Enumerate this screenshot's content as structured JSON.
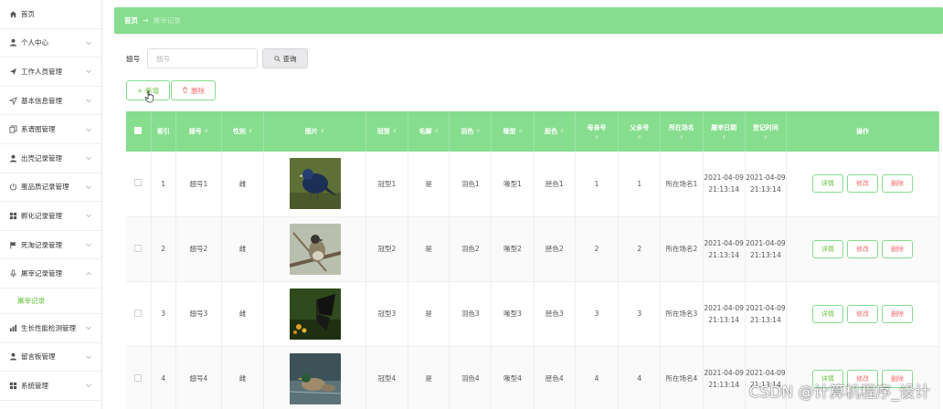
{
  "sidebar": {
    "items": [
      {
        "label": "首页",
        "icon": "home-icon",
        "expandable": false
      },
      {
        "label": "个人中心",
        "icon": "user-icon",
        "expandable": true
      },
      {
        "label": "工作人员管理",
        "icon": "send-icon",
        "expandable": true
      },
      {
        "label": "基本信息管理",
        "icon": "navigation-icon",
        "expandable": true
      },
      {
        "label": "系谱图管理",
        "icon": "copy-icon",
        "expandable": true
      },
      {
        "label": "出壳记录管理",
        "icon": "user-icon",
        "expandable": true
      },
      {
        "label": "蛋品质记录管理",
        "icon": "power-icon",
        "expandable": true
      },
      {
        "label": "孵化记录管理",
        "icon": "grid-icon",
        "expandable": true
      },
      {
        "label": "死淘记录管理",
        "icon": "flag-icon",
        "expandable": true
      },
      {
        "label": "屠宰记录管理",
        "icon": "microphone-icon",
        "expandable": true,
        "expanded": true
      },
      {
        "label": "生长性能检测管理",
        "icon": "chart-icon",
        "expandable": true
      },
      {
        "label": "留言板管理",
        "icon": "user-icon",
        "expandable": true
      },
      {
        "label": "系统管理",
        "icon": "grid-icon",
        "expandable": true
      }
    ],
    "active_sub": "屠宰记录"
  },
  "breadcrumb": {
    "home": "首页",
    "arrow": "→",
    "current": "屠宰记录"
  },
  "search": {
    "label": "翅号",
    "placeholder": "翅号",
    "button": "查询"
  },
  "actions": {
    "add": "新增",
    "delete": "删除"
  },
  "table": {
    "headers": [
      "索引",
      "翅号",
      "性别",
      "图片",
      "冠型",
      "毛脚",
      "羽色",
      "喙型",
      "胫色",
      "母亲号",
      "父亲号",
      "所在场名",
      "屠宰日期",
      "登记时间",
      "操作"
    ],
    "rows": [
      {
        "index": "1",
        "wing": "翅号1",
        "sex": "雌",
        "photo": "bird-photo",
        "comb": "冠型1",
        "feather_foot": "是",
        "color": "羽色1",
        "beak": "喙型1",
        "shank": "胫色1",
        "mother": "1",
        "father": "1",
        "farm": "所在场名1",
        "slaughter_date": "2021-04-09 21:13:14",
        "register_time": "2021-04-09 21:13:14"
      },
      {
        "index": "2",
        "wing": "翅号2",
        "sex": "雌",
        "photo": "bird-photo",
        "comb": "冠型2",
        "feather_foot": "是",
        "color": "羽色2",
        "beak": "喙型2",
        "shank": "胫色2",
        "mother": "2",
        "father": "2",
        "farm": "所在场名2",
        "slaughter_date": "2021-04-09 21:13:14",
        "register_time": "2021-04-09 21:13:14"
      },
      {
        "index": "3",
        "wing": "翅号3",
        "sex": "雌",
        "photo": "butterfly-photo",
        "comb": "冠型3",
        "feather_foot": "是",
        "color": "羽色3",
        "beak": "喙型3",
        "shank": "胫色3",
        "mother": "3",
        "father": "3",
        "farm": "所在场名3",
        "slaughter_date": "2021-04-09 21:13:14",
        "register_time": "2021-04-09 21:13:14"
      },
      {
        "index": "4",
        "wing": "翅号4",
        "sex": "雌",
        "photo": "duck-photo",
        "comb": "冠型4",
        "feather_foot": "是",
        "color": "羽色4",
        "beak": "喙型4",
        "shank": "胫色4",
        "mother": "4",
        "father": "4",
        "farm": "所在场名4",
        "slaughter_date": "2021-04-09 21:13:14",
        "register_time": "2021-04-09 21:13:14"
      }
    ],
    "ops": {
      "detail": "详情",
      "edit": "修改",
      "delete": "删除"
    }
  },
  "watermark": "CSDN @计算机程序_设计",
  "colors": {
    "accent": "#86dd8e",
    "danger": "#f56c6c",
    "success": "#67c23a"
  }
}
